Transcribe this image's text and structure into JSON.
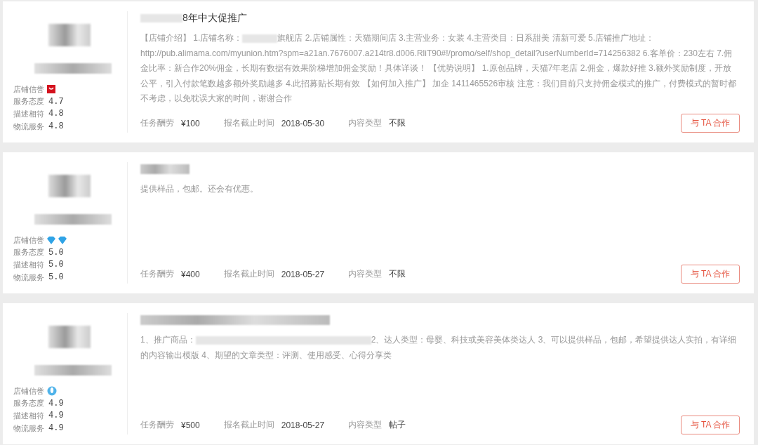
{
  "cards": [
    {
      "shop": {
        "badges": [
          {
            "kind": "tmall"
          }
        ],
        "credit_label": "店铺信誉",
        "ratings": [
          {
            "label": "服务态度",
            "value": "4.7"
          },
          {
            "label": "描述相符",
            "value": "4.8"
          },
          {
            "label": "物流服务",
            "value": "4.8"
          }
        ]
      },
      "title": [
        {
          "kind": "redacted"
        },
        {
          "kind": "text",
          "text": "8年中大促推广"
        }
      ],
      "description": [
        {
          "kind": "text",
          "text": "【店铺介绍】 1.店铺名称："
        },
        {
          "kind": "redacted"
        },
        {
          "kind": "text",
          "text": "旗舰店 2.店铺属性：天猫期间店 3.主营业务：女装 4.主营类目：日系甜美 清新可爱 5.店铺推广地址：http://pub.alimama.com/myunion.htm?spm=a21an.7676007.a214tr8.d006.RliT90#!/promo/self/shop_detail?userNumberId=714256382 6.客单价：230左右 7.佣金比率：新合作20%佣金，长期有数据有效果阶梯增加佣金奖励！具体详谈！ 【优势说明】 1.原创品牌，天猫7年老店 2.佣金，爆款好推 3.额外奖励制度，开放公平，引入付款笔数越多额外奖励越多 4.此招募贴长期有效 【如何加入推广】 加企 1411465526审核 注意：我们目前只支持佣金模式的推广，付费模式的暂时都不考虑，以免耽误大家的时间，谢谢合作"
        }
      ],
      "meta": [
        {
          "label": "任务酬劳",
          "value": "¥100"
        },
        {
          "label": "报名截止时间",
          "value": "2018-05-30"
        },
        {
          "label": "内容类型",
          "value": "不限"
        }
      ],
      "button": "与 TA 合作"
    },
    {
      "shop": {
        "badges": [
          {
            "kind": "diamond"
          },
          {
            "kind": "diamond"
          }
        ],
        "credit_label": "店铺信誉",
        "ratings": [
          {
            "label": "服务态度",
            "value": "5.0"
          },
          {
            "label": "描述相符",
            "value": "5.0"
          },
          {
            "label": "物流服务",
            "value": "5.0"
          }
        ]
      },
      "title": [
        {
          "kind": "redacted"
        }
      ],
      "description": [
        {
          "kind": "text",
          "text": "提供样品，包邮。还会有优惠。"
        }
      ],
      "meta": [
        {
          "label": "任务酬劳",
          "value": "¥400"
        },
        {
          "label": "报名截止时间",
          "value": "2018-05-27"
        },
        {
          "label": "内容类型",
          "value": "不限"
        }
      ],
      "button": "与 TA 合作"
    },
    {
      "shop": {
        "badges": [
          {
            "kind": "crown"
          }
        ],
        "credit_label": "店铺信誉",
        "ratings": [
          {
            "label": "服务态度",
            "value": "4.9"
          },
          {
            "label": "描述相符",
            "value": "4.9"
          },
          {
            "label": "物流服务",
            "value": "4.9"
          }
        ]
      },
      "title": [
        {
          "kind": "redacted"
        }
      ],
      "description": [
        {
          "kind": "text",
          "text": "1、推广商品："
        },
        {
          "kind": "redacted"
        },
        {
          "kind": "text",
          "text": "2、达人类型：母婴、科技或美容美体类达人 3、可以提供样品，包邮，希望提供达人实拍，有详细的内容输出模版 4、期望的文章类型：评测、使用感受、心得分享类"
        }
      ],
      "meta": [
        {
          "label": "任务酬劳",
          "value": "¥500"
        },
        {
          "label": "报名截止时间",
          "value": "2018-05-27"
        },
        {
          "label": "内容类型",
          "value": "帖子"
        }
      ],
      "button": "与 TA 合作"
    }
  ]
}
